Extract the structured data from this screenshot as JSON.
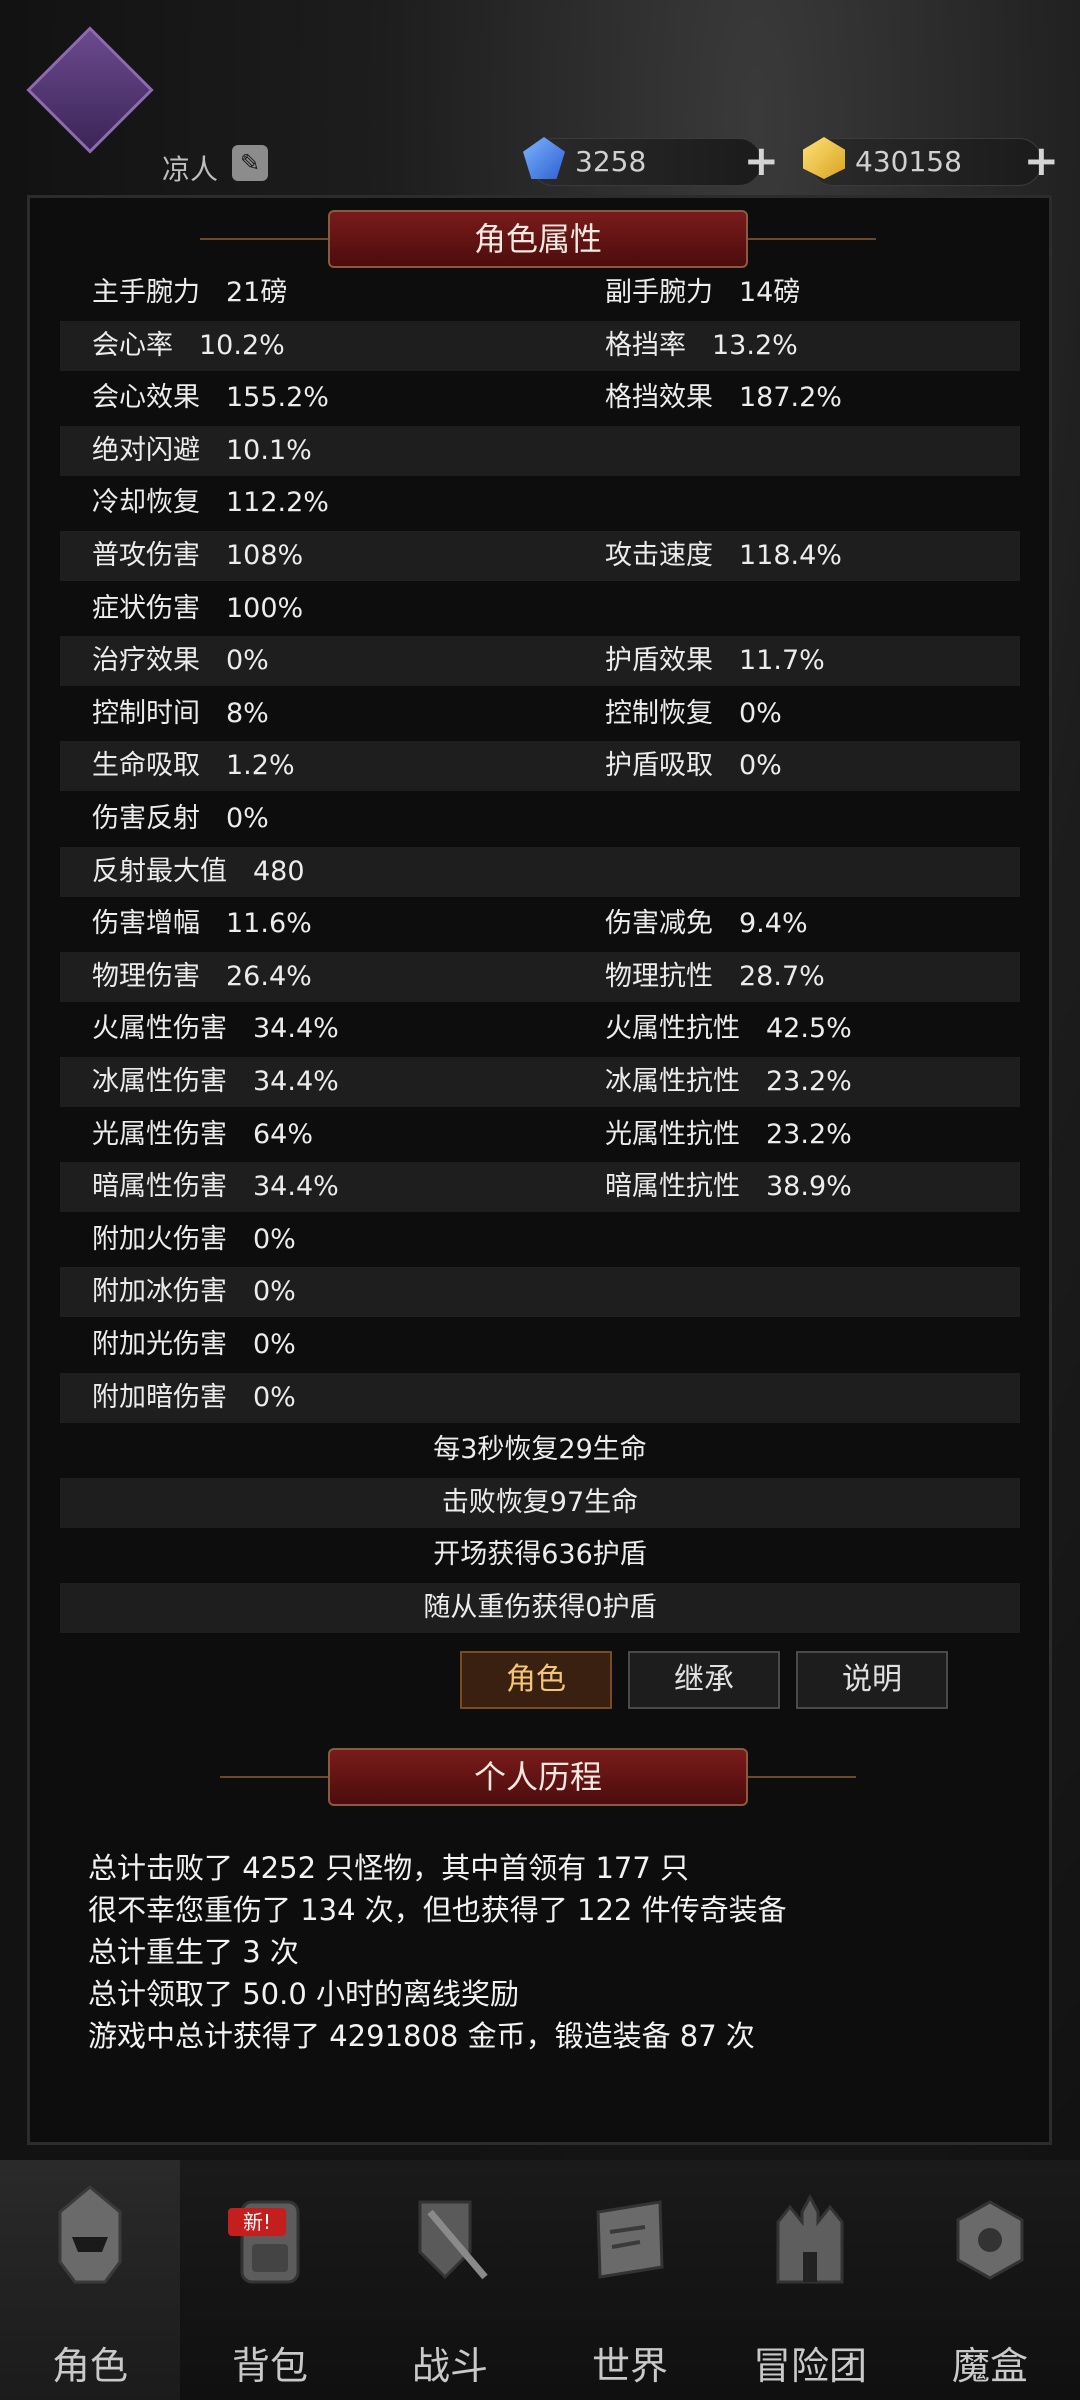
{
  "header": {
    "player_name": "凉人",
    "gems": "3258",
    "gold": "430158"
  },
  "panel": {
    "title": "角色属性",
    "rows": [
      {
        "l_label": "主手腕力",
        "l_value": "21磅",
        "r_label": "副手腕力",
        "r_value": "14磅"
      },
      {
        "l_label": "会心率",
        "l_value": "10.2%",
        "r_label": "格挡率",
        "r_value": "13.2%"
      },
      {
        "l_label": "会心效果",
        "l_value": "155.2%",
        "r_label": "格挡效果",
        "r_value": "187.2%"
      },
      {
        "l_label": "绝对闪避",
        "l_value": "10.1%",
        "r_label": "",
        "r_value": ""
      },
      {
        "l_label": "冷却恢复",
        "l_value": "112.2%",
        "r_label": "",
        "r_value": ""
      },
      {
        "l_label": "普攻伤害",
        "l_value": "108%",
        "r_label": "攻击速度",
        "r_value": "118.4%"
      },
      {
        "l_label": "症状伤害",
        "l_value": "100%",
        "r_label": "",
        "r_value": ""
      },
      {
        "l_label": "治疗效果",
        "l_value": "0%",
        "r_label": "护盾效果",
        "r_value": "11.7%"
      },
      {
        "l_label": "控制时间",
        "l_value": "8%",
        "r_label": "控制恢复",
        "r_value": "0%"
      },
      {
        "l_label": "生命吸取",
        "l_value": "1.2%",
        "r_label": "护盾吸取",
        "r_value": "0%"
      },
      {
        "l_label": "伤害反射",
        "l_value": "0%",
        "r_label": "",
        "r_value": ""
      },
      {
        "l_label": "反射最大值",
        "l_value": "480",
        "r_label": "",
        "r_value": ""
      },
      {
        "l_label": "伤害增幅",
        "l_value": "11.6%",
        "r_label": "伤害减免",
        "r_value": "9.4%"
      },
      {
        "l_label": "物理伤害",
        "l_value": "26.4%",
        "r_label": "物理抗性",
        "r_value": "28.7%"
      },
      {
        "l_label": "火属性伤害",
        "l_value": "34.4%",
        "r_label": "火属性抗性",
        "r_value": "42.5%"
      },
      {
        "l_label": "冰属性伤害",
        "l_value": "34.4%",
        "r_label": "冰属性抗性",
        "r_value": "23.2%"
      },
      {
        "l_label": "光属性伤害",
        "l_value": "64%",
        "r_label": "光属性抗性",
        "r_value": "23.2%"
      },
      {
        "l_label": "暗属性伤害",
        "l_value": "34.4%",
        "r_label": "暗属性抗性",
        "r_value": "38.9%"
      },
      {
        "l_label": "附加火伤害",
        "l_value": "0%",
        "r_label": "",
        "r_value": ""
      },
      {
        "l_label": "附加冰伤害",
        "l_value": "0%",
        "r_label": "",
        "r_value": ""
      },
      {
        "l_label": "附加光伤害",
        "l_value": "0%",
        "r_label": "",
        "r_value": ""
      },
      {
        "l_label": "附加暗伤害",
        "l_value": "0%",
        "r_label": "",
        "r_value": ""
      }
    ],
    "extra_rows": [
      "每3秒恢复29生命",
      "击败恢复97生命",
      "开场获得636护盾",
      "随从重伤获得0护盾"
    ]
  },
  "tabs": {
    "role": "角色",
    "inherit": "继承",
    "explain": "说明"
  },
  "history": {
    "title": "个人历程",
    "lines": [
      "总计击败了 4252 只怪物，其中首领有 177 只",
      "很不幸您重伤了 134 次，但也获得了 122 件传奇装备",
      "总计重生了 3 次",
      "总计领取了 50.0 小时的离线奖励",
      "游戏中总计获得了 4291808 金币，锻造装备 87 次"
    ]
  },
  "nav": {
    "items": [
      "角色",
      "背包",
      "战斗",
      "世界",
      "冒险团",
      "魔盒"
    ],
    "new_badge": "新!"
  }
}
